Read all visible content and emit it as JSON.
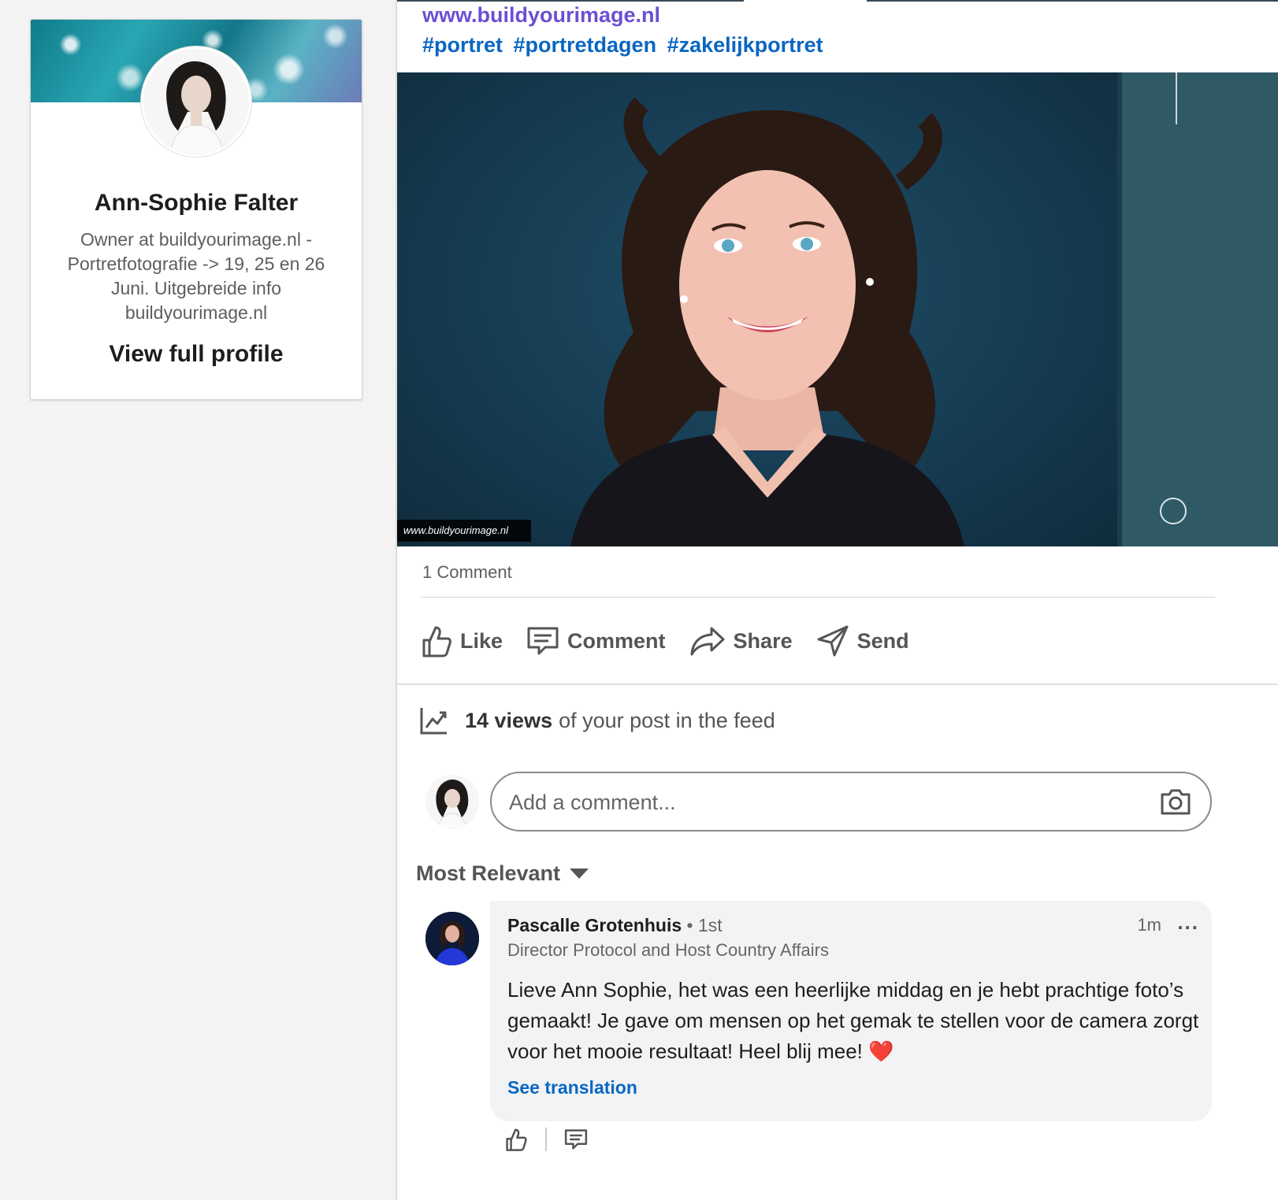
{
  "profile": {
    "name": "Ann-Sophie Falter",
    "headline": "Owner at buildyourimage.nl - Portretfotografie -> 19, 25 en 26 Juni. Uitgebreide info buildyourimage.nl",
    "view_profile_label": "View full profile"
  },
  "post": {
    "link_url": "www.buildyourimage.nl",
    "hashtags": [
      "#portret",
      "#portretdagen",
      "#zakelijkportret"
    ],
    "image_watermark": "www.buildyourimage.nl",
    "comment_count_label": "1 Comment",
    "actions": {
      "like": "Like",
      "comment": "Comment",
      "share": "Share",
      "send": "Send"
    },
    "views_count": "14 views",
    "views_suffix": "of your post in the feed",
    "comment_input_placeholder": "Add a comment...",
    "sort_label": "Most Relevant"
  },
  "comment": {
    "author": "Pascalle Grotenhuis",
    "degree": "• 1st",
    "author_title": "Director Protocol and Host Country Affairs",
    "time": "1m",
    "more_label": "...",
    "text": "Lieve Ann Sophie, het was een heerlijke middag en je hebt prachtige foto’s gemaakt! Je gave om mensen op het gemak te stellen voor de camera zorgt voor het mooie resultaat! Heel blij mee!",
    "emoji": "❤️",
    "translate_label": "See translation"
  },
  "colors": {
    "link_purple": "#6b4fd3",
    "link_blue": "#0a66c2",
    "muted_text": "#5e5e5e"
  }
}
